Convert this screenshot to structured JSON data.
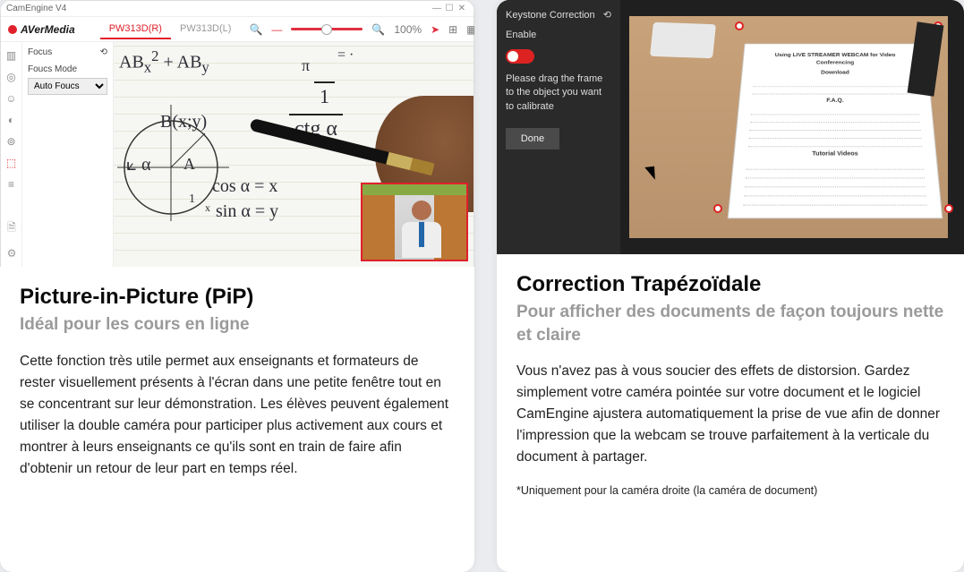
{
  "left": {
    "window_title": "CamEngine V4",
    "brand": "AVerMedia",
    "tabs": {
      "active": "PW313D(R)",
      "inactive": "PW313D(L)"
    },
    "zoom_label": "100%",
    "side": {
      "focus": "Focus",
      "focus_mode": "Foucs Mode",
      "auto_focus": "Auto Foucs"
    },
    "heading": "Picture-in-Picture (PiP)",
    "subheading": "Idéal pour les cours en ligne",
    "body": "Cette fonction très utile permet aux enseignants et formateurs de rester visuellement présents à l'écran dans une petite fenêtre tout en se concentrant sur leur démonstration. Les élèves peuvent également utiliser la double caméra pour participer plus activement aux cours et montrer à leurs enseignants ce qu'ils sont en train de faire afin d'obtenir un retour de leur part en temps réel."
  },
  "right": {
    "panel_title": "Keystone Correction",
    "enable_label": "Enable",
    "instruction": "Please drag the frame to the object you want to calibrate",
    "done": "Done",
    "doc_title": "Using LIVE STREAMER WEBCAM for Video Conferencing",
    "doc_h1": "Download",
    "doc_h2": "F.A.Q.",
    "doc_h3": "Tutorial Videos",
    "heading": "Correction Trapézoïdale",
    "subheading": "Pour afficher des documents de façon toujours nette et claire",
    "body": "Vous n'avez pas à vous soucier des effets de distorsion. Gardez simplement votre caméra pointée sur votre document et le logiciel CamEngine ajustera automatiquement la prise de vue afin de donner l'impression que la webcam se trouve parfaitement à la verticale du document à partager.",
    "footnote": "*Uniquement pour la caméra droite (la caméra de document)"
  }
}
